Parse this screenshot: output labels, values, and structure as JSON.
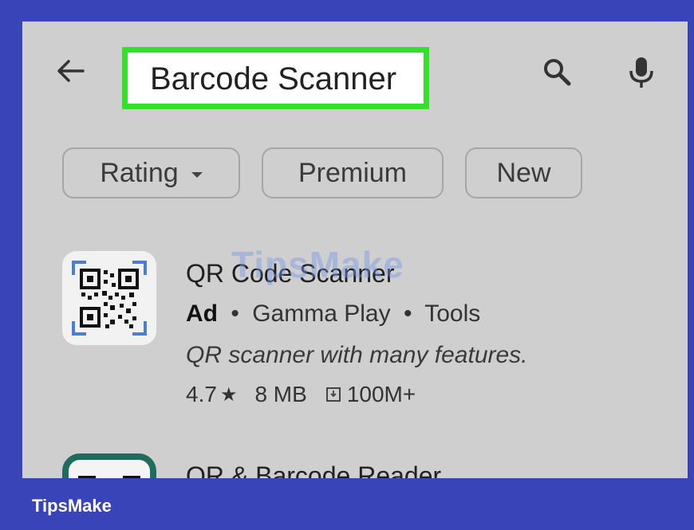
{
  "search": {
    "query": "Barcode Scanner"
  },
  "icons": {
    "back": "arrow-left-icon",
    "search": "search-icon",
    "mic": "mic-icon"
  },
  "filters": [
    {
      "label": "Rating",
      "has_dropdown": true
    },
    {
      "label": "Premium"
    },
    {
      "label": "New"
    }
  ],
  "results": [
    {
      "title": "QR Code Scanner",
      "ad_label": "Ad",
      "developer": "Gamma Play",
      "category": "Tools",
      "separator": "•",
      "description": "QR scanner with many features.",
      "rating": "4.7",
      "star": "★",
      "size": "8 MB",
      "downloads": "100M+"
    },
    {
      "title": "QR & Barcode Reader"
    }
  ],
  "watermark": "TipsMake",
  "brand": "TipsMake",
  "colors": {
    "frame": "#3944b8",
    "highlight": "#35e02a",
    "screen_bg": "#cfcfcf"
  }
}
